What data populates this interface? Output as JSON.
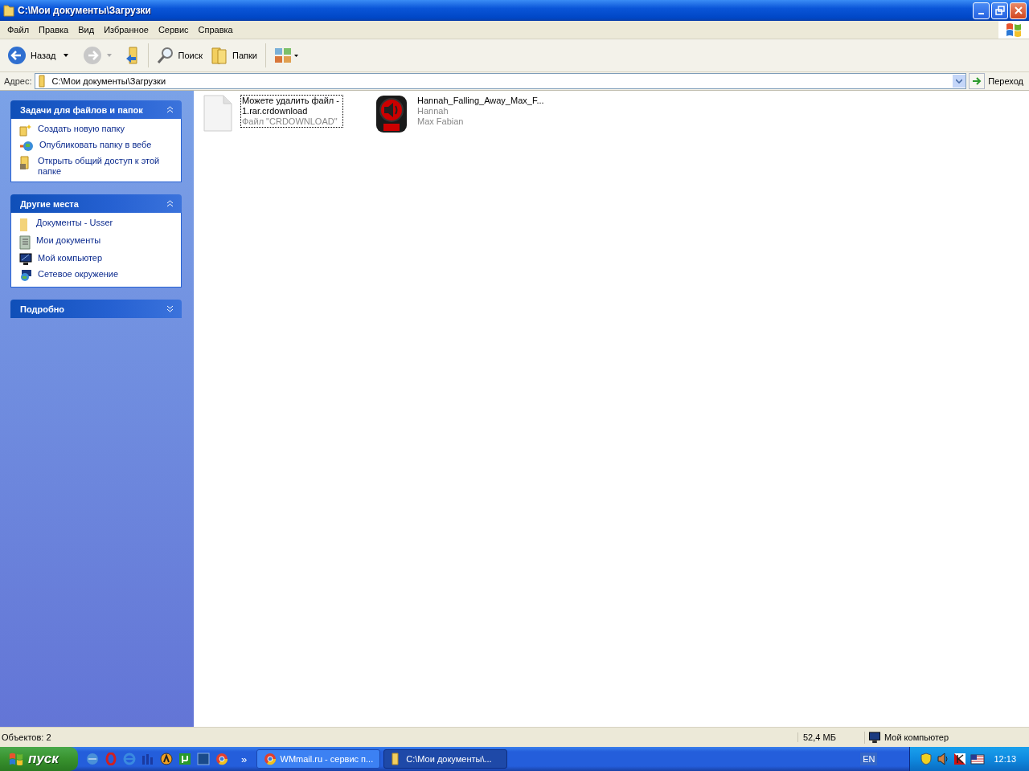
{
  "window": {
    "title": "C:\\Мои документы\\Загрузки"
  },
  "menu": [
    "Файл",
    "Правка",
    "Вид",
    "Избранное",
    "Сервис",
    "Справка"
  ],
  "toolbar": {
    "back": "Назад",
    "search": "Поиск",
    "folders": "Папки"
  },
  "address": {
    "label": "Адрес:",
    "value": "C:\\Мои документы\\Загрузки",
    "go": "Переход"
  },
  "panels": [
    {
      "title": "Задачи для файлов и папок",
      "expanded": true,
      "items": [
        "Создать новую папку",
        "Опубликовать папку в вебе",
        "Открыть общий доступ к этой папке"
      ]
    },
    {
      "title": "Другие места",
      "expanded": true,
      "items": [
        "Документы - Usser",
        "Мои документы",
        "Мой компьютер",
        "Сетевое окружение"
      ]
    },
    {
      "title": "Подробно",
      "expanded": false
    }
  ],
  "files": [
    {
      "kind": "file",
      "focused": true,
      "lines": [
        "Можете удалить файл -",
        "1.rar.crdownload"
      ],
      "sub": [
        "Файл \"CRDOWNLOAD\""
      ]
    },
    {
      "kind": "mp3",
      "focused": false,
      "lines": [
        "Hannah_Falling_Away_Max_F..."
      ],
      "sub": [
        "Hannah",
        "Max Fabian"
      ]
    }
  ],
  "status_bar": {
    "objects": "Объектов: 2",
    "size": "52,4 МБ",
    "zone": "Мой компьютер"
  },
  "taskbar": {
    "start": "пуск",
    "more": "»",
    "tasks": [
      {
        "label": "WMmail.ru - сервис п...",
        "selected": false,
        "kind": "browser"
      },
      {
        "label": "C:\\Мои документы\\...",
        "selected": true,
        "kind": "folder"
      }
    ],
    "lang": "EN",
    "clock": "12:13"
  }
}
